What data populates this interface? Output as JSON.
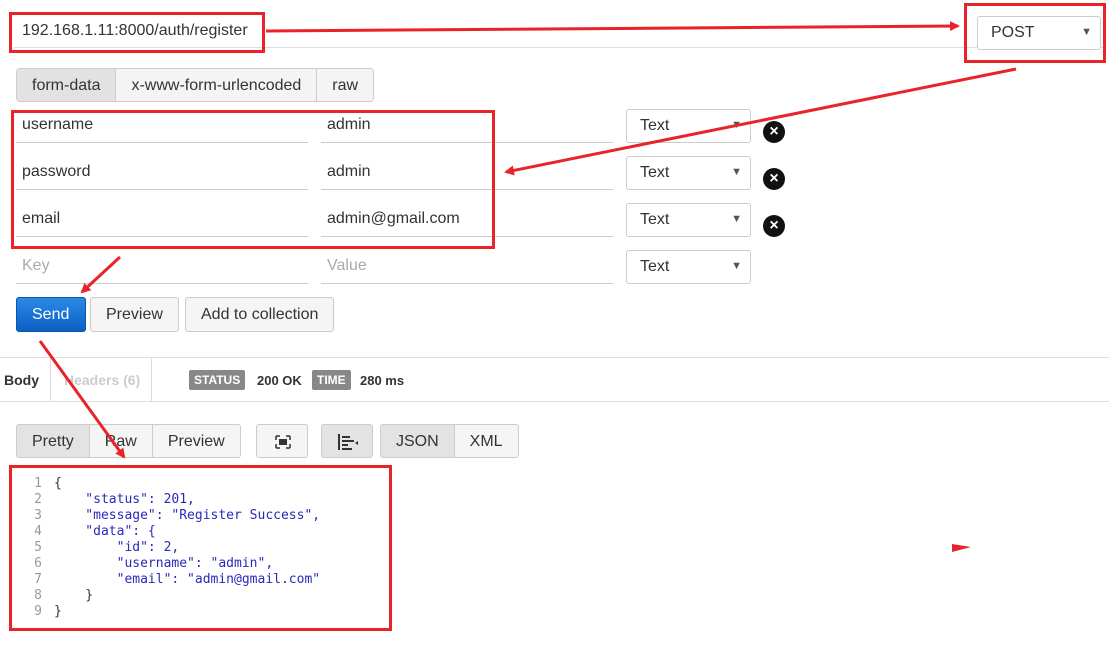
{
  "request": {
    "url": "192.168.1.11:8000/auth/register",
    "method": "POST",
    "tabs": [
      "form-data",
      "x-www-form-urlencoded",
      "raw"
    ],
    "rows": [
      {
        "key": "username",
        "value": "admin",
        "type": "Text"
      },
      {
        "key": "password",
        "value": "admin",
        "type": "Text"
      },
      {
        "key": "email",
        "value": "admin@gmail.com",
        "type": "Text"
      }
    ],
    "new_row": {
      "key_placeholder": "Key",
      "value_placeholder": "Value",
      "type": "Text"
    },
    "buttons": {
      "send": "Send",
      "preview": "Preview",
      "add": "Add to collection"
    }
  },
  "response": {
    "tabs": {
      "body": "Body",
      "headers": "Headers (6)"
    },
    "status_label": "STATUS",
    "status_value": "200 OK",
    "time_label": "TIME",
    "time_value": "280 ms",
    "view_modes": [
      "Pretty",
      "Raw",
      "Preview"
    ],
    "formats": [
      "JSON",
      "XML"
    ],
    "code_lines": [
      "{",
      "    \"status\": 201,",
      "    \"message\": \"Register Success\",",
      "    \"data\": {",
      "        \"id\": 2,",
      "        \"username\": \"admin\",",
      "        \"email\": \"admin@gmail.com\"",
      "    }",
      "}"
    ]
  },
  "annotation_color": "#e8232a"
}
